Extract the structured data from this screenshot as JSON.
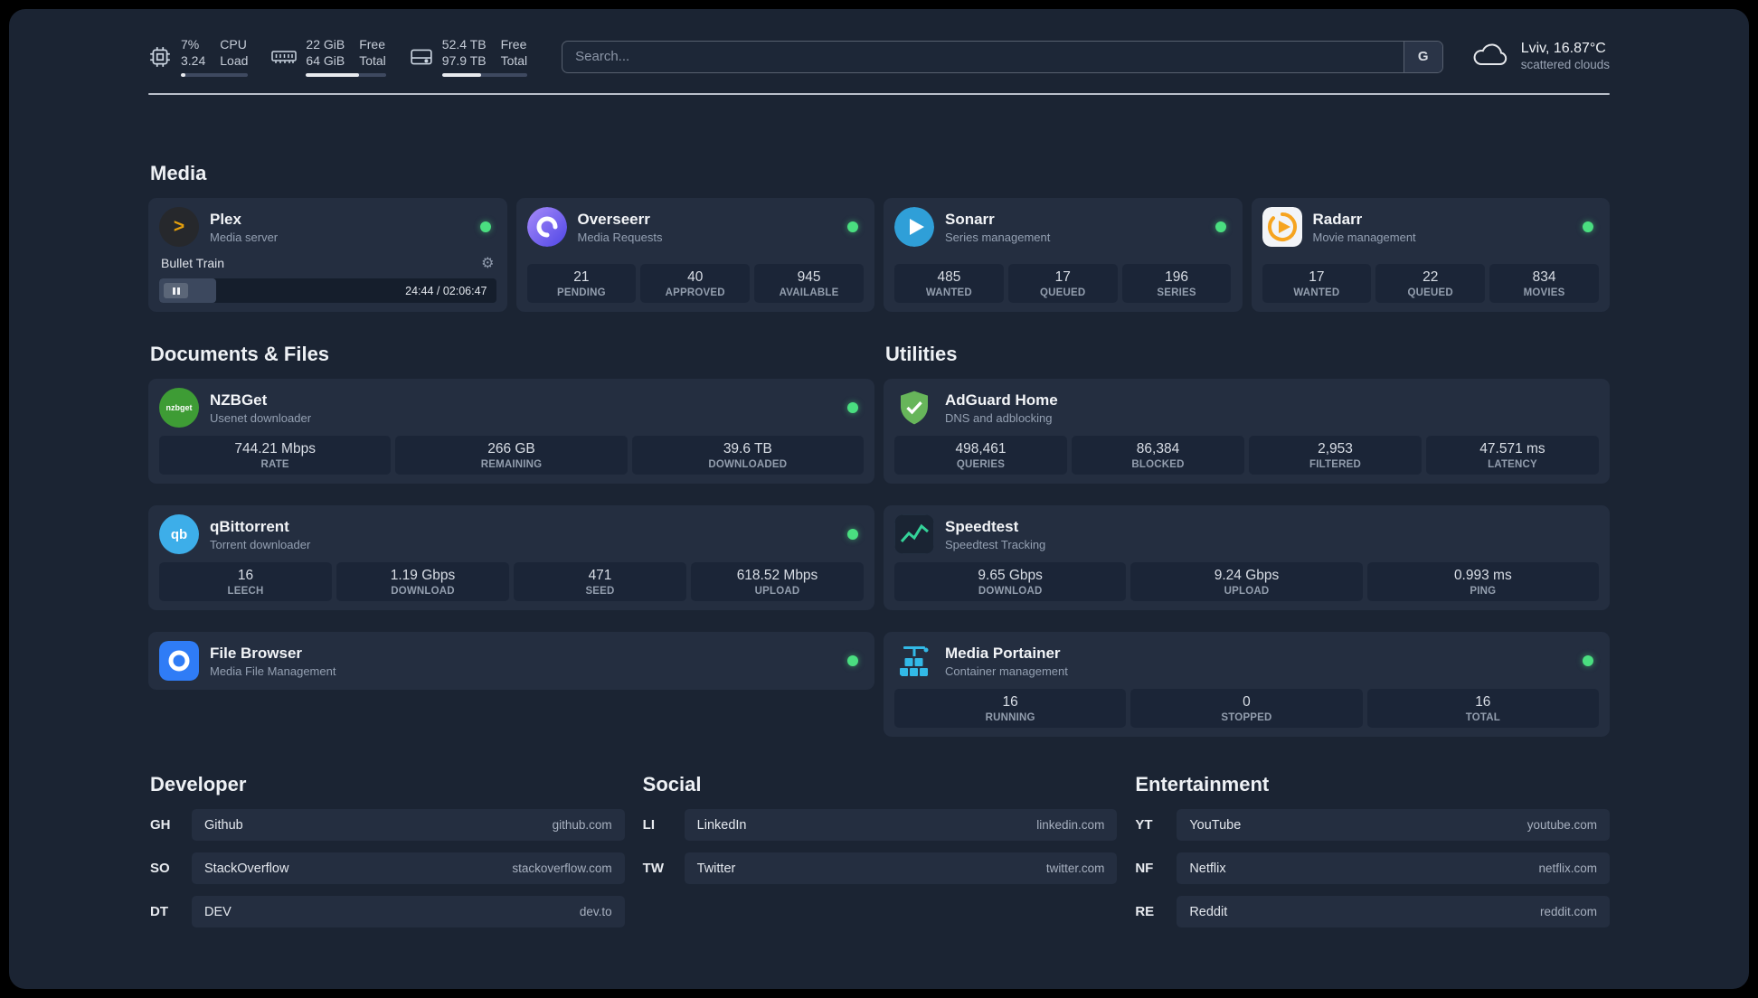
{
  "topbar": {
    "cpu": {
      "value_top": "7%",
      "value_bottom": "3.24",
      "label_top": "CPU",
      "label_bottom": "Load",
      "progress": 7
    },
    "memory": {
      "value_top": "22 GiB",
      "value_bottom": "64 GiB",
      "label_top": "Free",
      "label_bottom": "Total",
      "progress": 66
    },
    "disk": {
      "value_top": "52.4 TB",
      "value_bottom": "97.9 TB",
      "label_top": "Free",
      "label_bottom": "Total",
      "progress": 46
    },
    "search": {
      "placeholder": "Search...",
      "engine": "G"
    },
    "weather": {
      "location": "Lviv, 16.87°C",
      "condition": "scattered clouds"
    }
  },
  "sections": {
    "media_title": "Media",
    "documents_title": "Documents & Files",
    "utilities_title": "Utilities"
  },
  "media": {
    "plex": {
      "name": "Plex",
      "subtitle": "Media server",
      "track": "Bullet Train",
      "time": "24:44 / 02:06:47",
      "progress": 17
    },
    "overseerr": {
      "name": "Overseerr",
      "subtitle": "Media Requests",
      "stats": [
        {
          "value": "21",
          "label": "PENDING"
        },
        {
          "value": "40",
          "label": "APPROVED"
        },
        {
          "value": "945",
          "label": "AVAILABLE"
        }
      ]
    },
    "sonarr": {
      "name": "Sonarr",
      "subtitle": "Series management",
      "stats": [
        {
          "value": "485",
          "label": "WANTED"
        },
        {
          "value": "17",
          "label": "QUEUED"
        },
        {
          "value": "196",
          "label": "SERIES"
        }
      ]
    },
    "radarr": {
      "name": "Radarr",
      "subtitle": "Movie management",
      "stats": [
        {
          "value": "17",
          "label": "WANTED"
        },
        {
          "value": "22",
          "label": "QUEUED"
        },
        {
          "value": "834",
          "label": "MOVIES"
        }
      ]
    }
  },
  "documents": {
    "nzbget": {
      "name": "NZBGet",
      "subtitle": "Usenet downloader",
      "stats": [
        {
          "value": "744.21 Mbps",
          "label": "RATE"
        },
        {
          "value": "266 GB",
          "label": "REMAINING"
        },
        {
          "value": "39.6 TB",
          "label": "DOWNLOADED"
        }
      ]
    },
    "qbittorrent": {
      "name": "qBittorrent",
      "subtitle": "Torrent downloader",
      "stats": [
        {
          "value": "16",
          "label": "LEECH"
        },
        {
          "value": "1.19 Gbps",
          "label": "DOWNLOAD"
        },
        {
          "value": "471",
          "label": "SEED"
        },
        {
          "value": "618.52 Mbps",
          "label": "UPLOAD"
        }
      ]
    },
    "filebrowser": {
      "name": "File Browser",
      "subtitle": "Media File Management"
    }
  },
  "utilities": {
    "adguard": {
      "name": "AdGuard Home",
      "subtitle": "DNS and adblocking",
      "stats": [
        {
          "value": "498,461",
          "label": "QUERIES"
        },
        {
          "value": "86,384",
          "label": "BLOCKED"
        },
        {
          "value": "2,953",
          "label": "FILTERED"
        },
        {
          "value": "47.571 ms",
          "label": "LATENCY"
        }
      ]
    },
    "speedtest": {
      "name": "Speedtest",
      "subtitle": "Speedtest Tracking",
      "stats": [
        {
          "value": "9.65 Gbps",
          "label": "DOWNLOAD"
        },
        {
          "value": "9.24 Gbps",
          "label": "UPLOAD"
        },
        {
          "value": "0.993 ms",
          "label": "PING"
        }
      ]
    },
    "portainer": {
      "name": "Media Portainer",
      "subtitle": "Container management",
      "stats": [
        {
          "value": "16",
          "label": "RUNNING"
        },
        {
          "value": "0",
          "label": "STOPPED"
        },
        {
          "value": "16",
          "label": "TOTAL"
        }
      ]
    }
  },
  "bookmarks": {
    "developer": {
      "title": "Developer",
      "items": [
        {
          "abbr": "GH",
          "name": "Github",
          "url": "github.com"
        },
        {
          "abbr": "SO",
          "name": "StackOverflow",
          "url": "stackoverflow.com"
        },
        {
          "abbr": "DT",
          "name": "DEV",
          "url": "dev.to"
        }
      ]
    },
    "social": {
      "title": "Social",
      "items": [
        {
          "abbr": "LI",
          "name": "LinkedIn",
          "url": "linkedin.com"
        },
        {
          "abbr": "TW",
          "name": "Twitter",
          "url": "twitter.com"
        }
      ]
    },
    "entertainment": {
      "title": "Entertainment",
      "items": [
        {
          "abbr": "YT",
          "name": "YouTube",
          "url": "youtube.com"
        },
        {
          "abbr": "NF",
          "name": "Netflix",
          "url": "netflix.com"
        },
        {
          "abbr": "RE",
          "name": "Reddit",
          "url": "reddit.com"
        }
      ]
    }
  },
  "icons": {
    "cpu": "cpu-chip",
    "memory": "ram-module",
    "disk": "hard-drive",
    "weather": "cloud",
    "gear": "⚙",
    "plex_glyph": ">",
    "qbittorrent_glyph": "qb",
    "nzbget_glyph": "nzbget"
  }
}
